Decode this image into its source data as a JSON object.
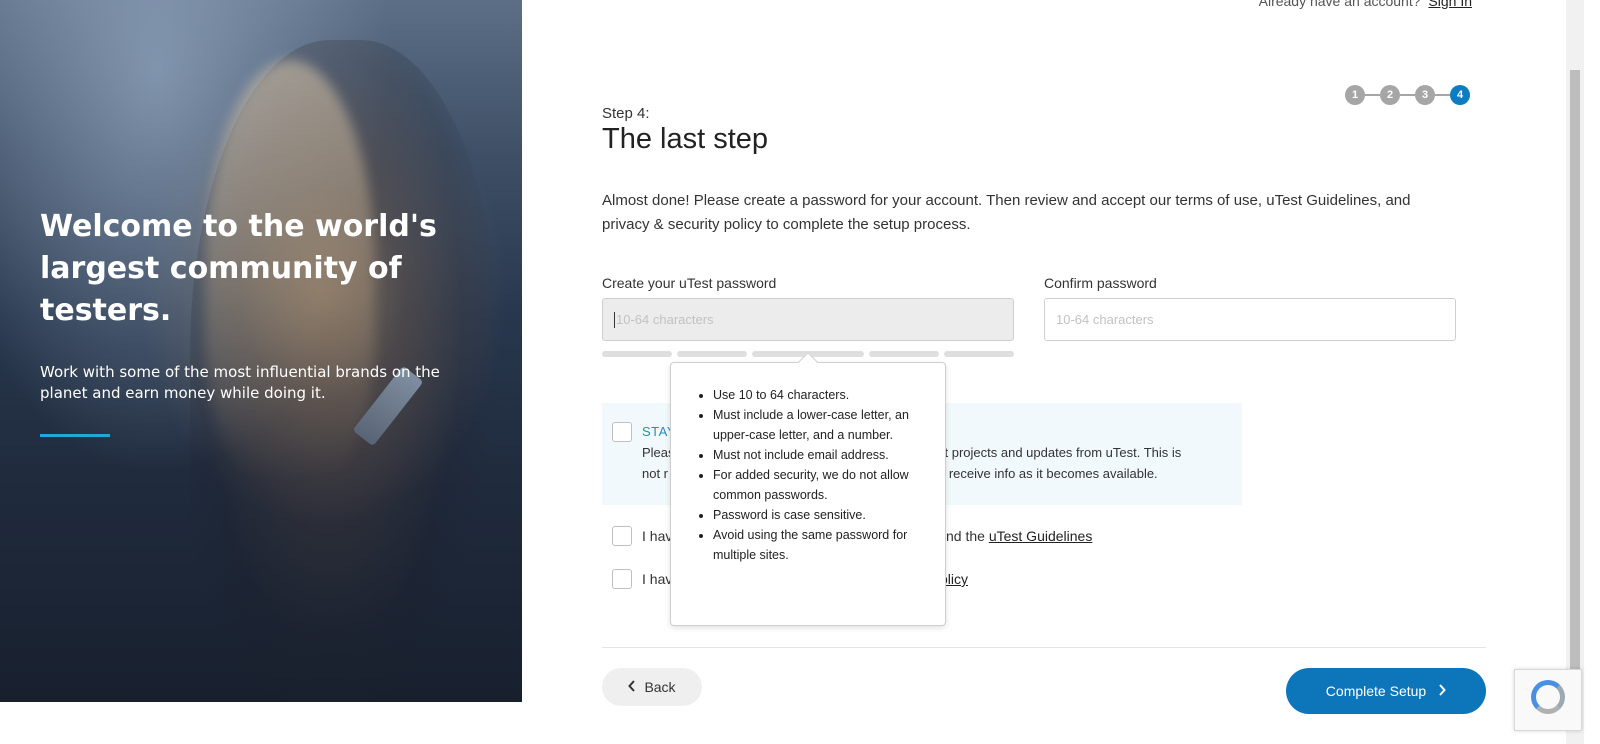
{
  "hero": {
    "headline": "Welcome to the world's largest community of testers.",
    "subtext": "Work with some of the most influential brands on the planet and earn money while doing it."
  },
  "header": {
    "account_prompt": "Already have an account?",
    "signin_label": "Sign In"
  },
  "stepper": {
    "steps": [
      "1",
      "2",
      "3",
      "4"
    ],
    "active": 4
  },
  "step": {
    "label": "Step 4:",
    "title": "The last step",
    "intro": "Almost done! Please create a password for your account. Then review and accept our terms of use, uTest Guidelines, and privacy & security policy to complete the setup process."
  },
  "form": {
    "password_label": "Create your uTest password",
    "password_placeholder": "10-64 characters",
    "confirm_label": "Confirm password",
    "confirm_placeholder": "10-64 characters"
  },
  "tooltip": {
    "rules": [
      "Use 10 to 64 characters.",
      "Must include a lower-case letter, an upper-case letter, and a number.",
      "Must not include email address.",
      "For added security, we do not allow common passwords.",
      "Password is case sensitive.",
      "Avoid using the same password for multiple sites."
    ]
  },
  "stay": {
    "title_visible": "STAY",
    "line1_left": "Pleas",
    "line1_right": "st projects and updates from uTest. This is",
    "line2_left": "not r",
    "line2_right": "o receive info as it becomes available."
  },
  "agreements": {
    "terms_left": "I hav",
    "terms_right": "nd the",
    "terms_link": "uTest Guidelines",
    "privacy_left": "I hav",
    "privacy_link": "olicy"
  },
  "buttons": {
    "back": "Back",
    "complete": "Complete Setup"
  },
  "colors": {
    "primary": "#0d76bb",
    "stepper_active": "#0d7cc1",
    "stepper_inactive": "#a6a6a6",
    "accent": "#1fa9d6"
  }
}
